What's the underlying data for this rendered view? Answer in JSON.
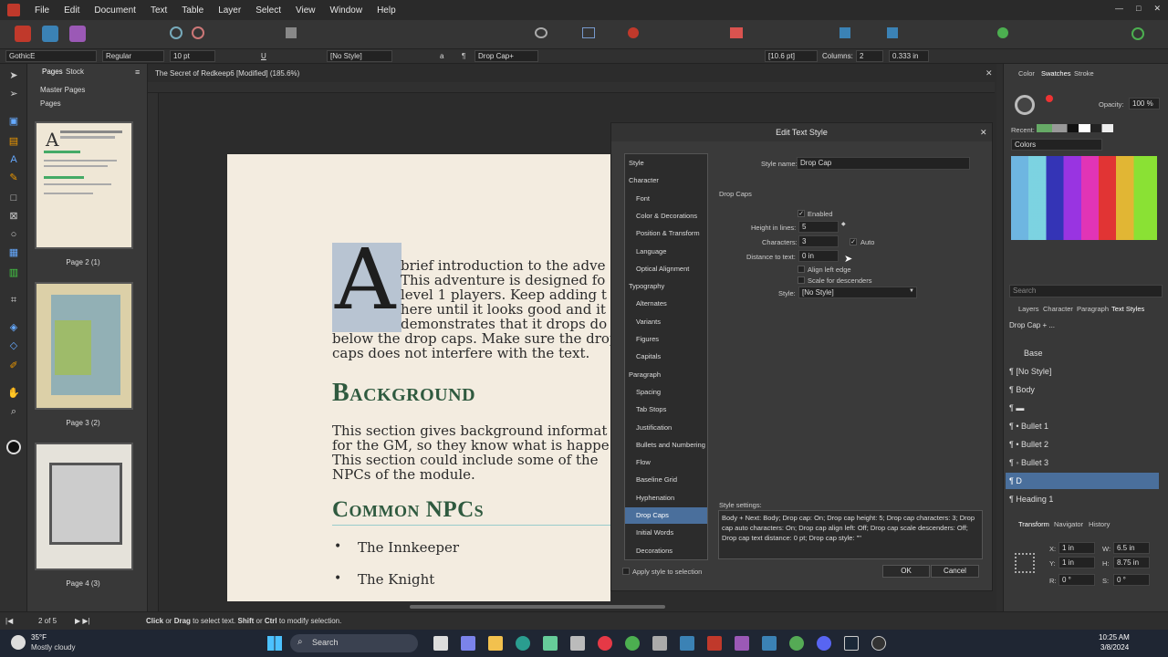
{
  "menu": [
    "File",
    "Edit",
    "Document",
    "Text",
    "Table",
    "Layer",
    "Select",
    "View",
    "Window",
    "Help"
  ],
  "window_controls": [
    "—",
    "□",
    "✕"
  ],
  "context_bar": {
    "font_family": "GothicE",
    "font_style": "Regular",
    "font_size": "10 pt",
    "para_style": "[No Style]",
    "char_style": "Drop Cap+",
    "leading": "[10.6 pt]",
    "columns_label": "Columns:",
    "columns_value": "2",
    "gutter": "0.333 in"
  },
  "document_tab": "The Secret of Redkeep6 [Modified] (185.6%)",
  "pages_panel": {
    "tabs": [
      "Pages",
      "Stock"
    ],
    "master_pages": "Master Pages",
    "pages": "Pages",
    "thumbs": [
      "Page 2 (1)",
      "Page 3 (2)",
      "Page 4 (3)"
    ]
  },
  "document": {
    "dropcap": "A",
    "intro_lines": [
      "brief introduction to the adve",
      "This adventure is designed fo",
      "level 1 players. Keep adding t",
      "here until it looks good and it",
      "demonstrates that it drops do"
    ],
    "intro_after": [
      "below the drop caps. Make sure the drop",
      "caps does not interfere with the text."
    ],
    "heading1": "Background",
    "body2": [
      "This section gives background informat",
      "for the GM, so they know what is happe",
      "This section could include some of the",
      "NPCs of the module."
    ],
    "heading2": "Common NPCs",
    "bullets": [
      "The Innkeeper",
      "The Knight"
    ]
  },
  "dialog": {
    "title": "Edit Text Style",
    "style_name_label": "Style name:",
    "style_name": "Drop Cap",
    "categories": [
      {
        "label": "Style",
        "kind": "top"
      },
      {
        "label": "Character",
        "kind": "top"
      },
      {
        "label": "Font",
        "kind": "sub"
      },
      {
        "label": "Color & Decorations",
        "kind": "sub"
      },
      {
        "label": "Position & Transform",
        "kind": "sub"
      },
      {
        "label": "Language",
        "kind": "sub"
      },
      {
        "label": "Optical Alignment",
        "kind": "sub"
      },
      {
        "label": "Typography",
        "kind": "top"
      },
      {
        "label": "Alternates",
        "kind": "sub"
      },
      {
        "label": "Variants",
        "kind": "sub"
      },
      {
        "label": "Figures",
        "kind": "sub"
      },
      {
        "label": "Capitals",
        "kind": "sub"
      },
      {
        "label": "Paragraph",
        "kind": "top"
      },
      {
        "label": "Spacing",
        "kind": "sub"
      },
      {
        "label": "Tab Stops",
        "kind": "sub"
      },
      {
        "label": "Justification",
        "kind": "sub"
      },
      {
        "label": "Bullets and Numbering",
        "kind": "sub"
      },
      {
        "label": "Flow",
        "kind": "sub"
      },
      {
        "label": "Baseline Grid",
        "kind": "sub"
      },
      {
        "label": "Hyphenation",
        "kind": "sub"
      },
      {
        "label": "Drop Caps",
        "kind": "sub",
        "selected": true
      },
      {
        "label": "Initial Words",
        "kind": "sub"
      },
      {
        "label": "Decorations",
        "kind": "sub"
      }
    ],
    "section": "Drop Caps",
    "enabled_label": "Enabled",
    "height_label": "Height in lines:",
    "height_value": "5",
    "characters_label": "Characters:",
    "characters_value": "3",
    "auto_label": "Auto",
    "distance_label": "Distance to text:",
    "distance_value": "0 in",
    "align_left_label": "Align left edge",
    "scale_desc_label": "Scale for descenders",
    "style_label": "Style:",
    "style_value": "[No Style]",
    "settings_label": "Style settings:",
    "settings_text": "Body + Next: Body; Drop cap: On; Drop cap height: 5; Drop cap characters: 3; Drop cap auto characters: On; Drop cap align left: Off; Drop cap scale descenders: Off; Drop cap text distance: 0 pt; Drop cap style: \"\"",
    "apply_label": "Apply style to selection",
    "ok": "OK",
    "cancel": "Cancel"
  },
  "right_panel": {
    "top_tabs": [
      "Color",
      "Swatches",
      "Stroke"
    ],
    "opacity_label": "Opacity:",
    "opacity_value": "100 %",
    "recent_label": "Recent:",
    "palette": "Colors",
    "search_placeholder": "Search",
    "mid_tabs": [
      "Layers",
      "Character",
      "Paragraph",
      "Text Styles"
    ],
    "styles": [
      {
        "label": "Drop Cap + ...",
        "indent": 0
      },
      {
        "label": "Base",
        "indent": 1
      },
      {
        "label": "¶ [No Style]",
        "indent": 0
      },
      {
        "label": "¶ Body",
        "indent": 0
      },
      {
        "label": "¶ ▬",
        "indent": 0
      },
      {
        "label": "¶ •   Bullet 1",
        "indent": 0
      },
      {
        "label": "¶      •   Bullet 2",
        "indent": 0
      },
      {
        "label": "¶          ◦   Bullet 3",
        "indent": 0
      },
      {
        "label": "¶ D",
        "indent": 0,
        "selected": true
      },
      {
        "label": "¶            Heading 1",
        "indent": 0
      }
    ],
    "bottom_tabs": [
      "Transform",
      "Navigator",
      "History"
    ],
    "transform": {
      "x": "1 in",
      "y": "1 in",
      "w": "6.5 in",
      "h": "8.75 in",
      "r": "0 °",
      "s": "0 °"
    }
  },
  "status": {
    "page_indicator": "2 of 5",
    "hint_click": "Click",
    "hint_or": " or ",
    "hint_drag": "Drag",
    "hint_rest": " to select text. ",
    "hint_shift": "Shift",
    "hint_or2": " or ",
    "hint_ctrl": "Ctrl",
    "hint_end": " to modify selection."
  },
  "taskbar": {
    "weather_temp": "35°F",
    "weather_desc": "Mostly cloudy",
    "search": "Search",
    "time": "10:25 AM",
    "date": "3/8/2024"
  }
}
